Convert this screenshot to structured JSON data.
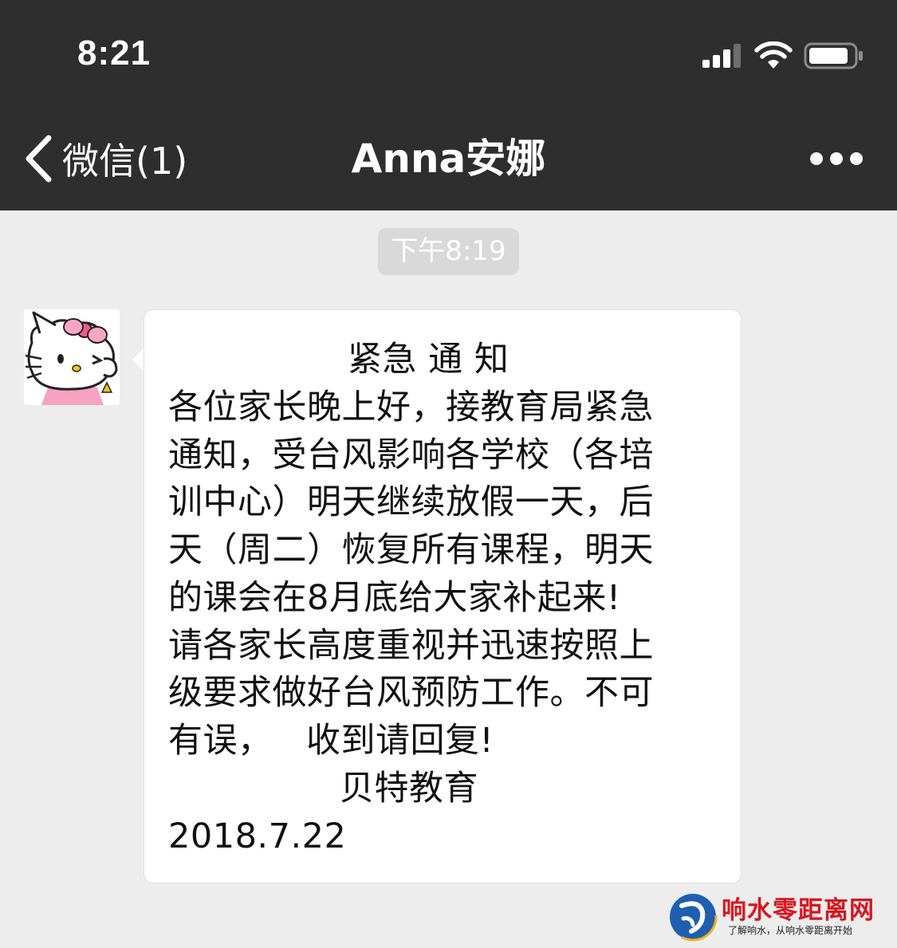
{
  "status_bar": {
    "time": "8:21",
    "signal_icon": "cellular-signal-icon",
    "wifi_icon": "wifi-icon",
    "battery_icon": "battery-icon"
  },
  "nav": {
    "back_icon": "chevron-left-icon",
    "back_label": "微信(1)",
    "title": "Anna安娜",
    "more_icon": "more-dots-icon"
  },
  "chat": {
    "timestamp": "下午8:19",
    "message": {
      "sender_avatar": "hello-kitty-avatar",
      "lines": [
        "紧急 通 知",
        "各位家长晚上好，接教育局紧急",
        "通知，受台风影响各学校（各培",
        "训中心）明天继续放假一天，后",
        "天（周二）恢复所有课程，明天",
        "的课会在8月底给大家补起来!",
        "请各家长高度重视并迅速按照上",
        "级要求做好台风预防工作。不可",
        "有误，   收到请回复!",
        "贝特教育",
        "2018.7.22"
      ]
    }
  },
  "watermark": {
    "title": "响水零距离网",
    "subtitle": "了解响水，从响水零距离开始"
  },
  "colors": {
    "nav_background": "#2e2e2e",
    "chat_background": "#ededed",
    "bubble": "#ffffff",
    "watermark_red": "#d9161f",
    "watermark_blue": "#1f5fb0"
  }
}
